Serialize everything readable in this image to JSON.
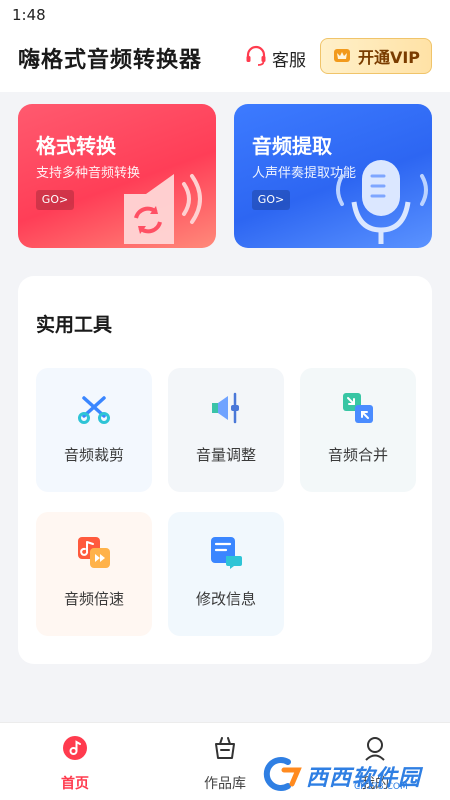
{
  "status_bar": {
    "time": "1:48"
  },
  "header": {
    "title": "嗨格式音频转换器",
    "service_label": "客服",
    "vip_label": "开通VIP"
  },
  "cards": [
    {
      "title": "格式转换",
      "subtitle": "支持多种音频转换",
      "go": "GO>"
    },
    {
      "title": "音频提取",
      "subtitle": "人声伴奏提取功能",
      "go": "GO>"
    }
  ],
  "tools": {
    "title": "实用工具",
    "items": [
      {
        "label": "音频裁剪",
        "icon": "scissors-icon"
      },
      {
        "label": "音量调整",
        "icon": "volume-adjust-icon"
      },
      {
        "label": "音频合并",
        "icon": "merge-icon"
      },
      {
        "label": "音频倍速",
        "icon": "speed-icon"
      },
      {
        "label": "修改信息",
        "icon": "edit-info-icon"
      }
    ]
  },
  "bottom_nav": {
    "items": [
      {
        "label": "首页",
        "icon": "home-music-icon",
        "active": true
      },
      {
        "label": "作品库",
        "icon": "bag-icon",
        "active": false
      },
      {
        "label": "我的",
        "icon": "profile-icon",
        "active": false
      }
    ]
  },
  "watermark": {
    "brand": "西西软件园",
    "url": "CR173.COM"
  },
  "colors": {
    "accent_red": "#ff3b4e",
    "accent_blue": "#2d66f2",
    "vip_gold": "#f0c46a"
  }
}
